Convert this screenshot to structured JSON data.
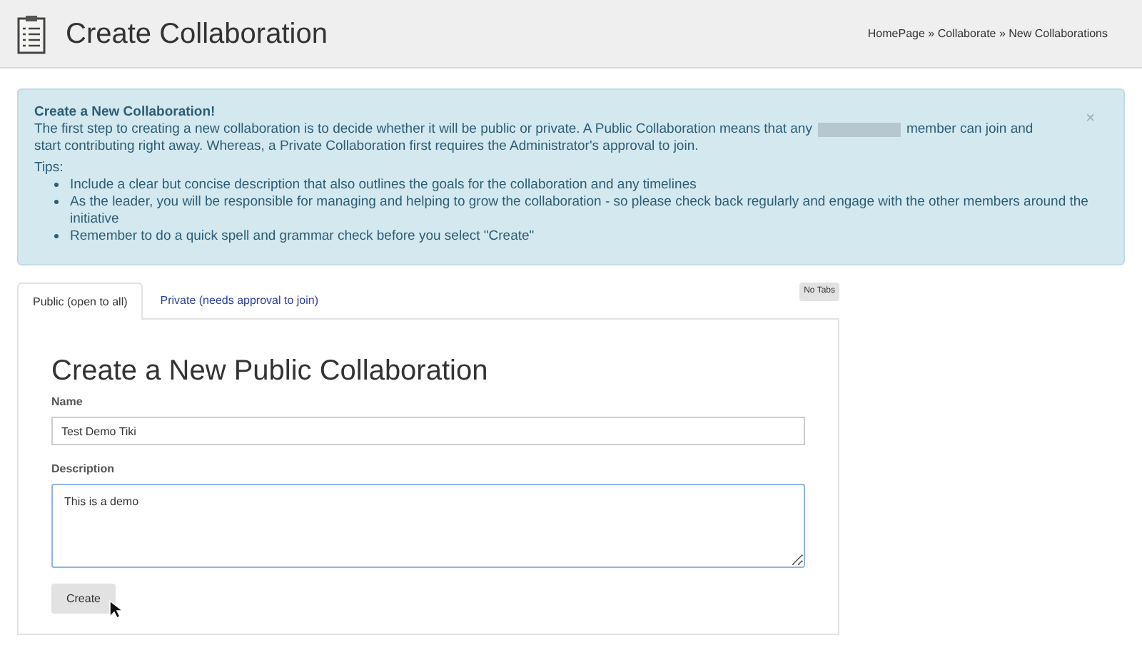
{
  "header": {
    "title": "Create Collaboration",
    "breadcrumb": "HomePage » Collaborate » New Collaborations"
  },
  "alert": {
    "heading": "Create a New Collaboration!",
    "text_before": "The first step to creating a new collaboration is to decide whether it will be public or private. A Public Collaboration means that any",
    "text_after": "member can join and",
    "text_line2": "start contributing right away. Whereas, a Private Collaboration first requires the Administrator's approval to join.",
    "close": "×",
    "tips_label": "Tips:",
    "tips": [
      "Include a clear but concise description that also outlines the goals for the collaboration and any timelines",
      "As the leader, you will be responsible for managing and helping to grow the collaboration - so please check back regularly and engage with the other members around the initiative",
      "Remember to do a quick spell and grammar check before you select \"Create\""
    ]
  },
  "tabs": [
    {
      "label": "Public (open to all)",
      "selected": true
    },
    {
      "label": "Private (needs approval to join)",
      "selected": false
    }
  ],
  "no_tabs_button": "No Tabs",
  "form": {
    "heading": "Create a New Public Collaboration",
    "name_label": "Name",
    "name_value": "Test Demo Tiki",
    "description_label": "Description",
    "description_value": "This is a demo",
    "submit": "Create"
  }
}
